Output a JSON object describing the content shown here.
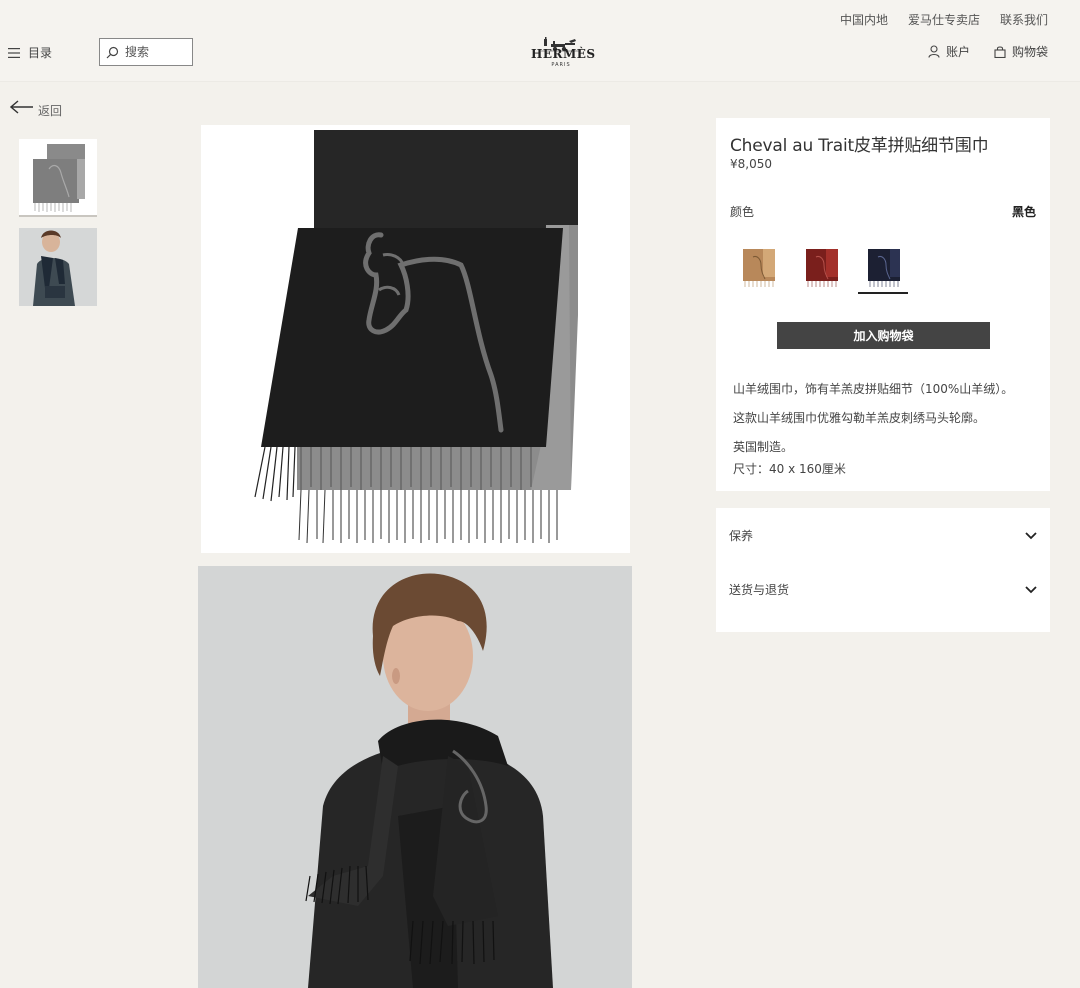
{
  "header": {
    "top_links": [
      "中国内地",
      "爱马仕专卖店",
      "联系我们"
    ],
    "menu_label": "目录",
    "search_placeholder": "搜索",
    "logo_text": "HERMÈS",
    "logo_sub": "PARIS",
    "account_label": "账户",
    "bag_label": "购物袋"
  },
  "nav": {
    "back_label": "返回"
  },
  "product": {
    "title": "Cheval au Trait皮革拼贴细节围巾",
    "price": "¥8,050",
    "color_label": "颜色",
    "color_value": "黑色",
    "swatches": [
      {
        "name": "camel",
        "color": "#b8885a"
      },
      {
        "name": "burgundy",
        "color": "#7a1f1c"
      },
      {
        "name": "navy",
        "color": "#1c2033"
      }
    ],
    "selected_swatch": 2,
    "add_to_bag": "加入购物袋",
    "description": [
      "山羊绒围巾，饰有羊羔皮拼贴细节（100%山羊绒）。",
      "这款山羊绒围巾优雅勾勒羊羔皮刺绣马头轮廓。",
      "英国制造。",
      "尺寸：40 x 160厘米"
    ]
  },
  "accordion": [
    {
      "label": "保养"
    },
    {
      "label": "送货与退货"
    }
  ],
  "colors": {
    "accent": "#444444",
    "background": "#f3f1ec",
    "panel": "#ffffff"
  }
}
